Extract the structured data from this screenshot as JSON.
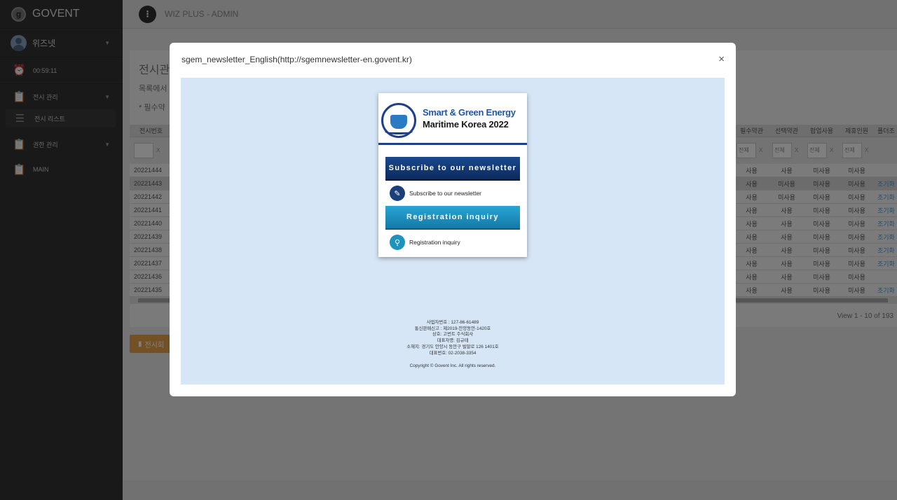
{
  "app": {
    "brand": "GOVENT",
    "top_title": "WIZ PLUS - ADMIN"
  },
  "sidebar": {
    "user": "위즈넷",
    "timer": "00:59:11",
    "items": [
      {
        "label": "전시 관리"
      },
      {
        "label": "전시 리스트"
      },
      {
        "label": "권한 관리"
      },
      {
        "label": "MAIN"
      }
    ]
  },
  "page": {
    "title": "전시관",
    "desc": "목록에서",
    "note": "* 필수약",
    "add_button": "전시회",
    "pager": "View 1 - 10 of 193"
  },
  "grid": {
    "headers": {
      "id": "전시번호",
      "req": "필수약관",
      "opt": "선택약관",
      "popup": "팝업사용",
      "partner": "제휴인원",
      "folder": "폴더조"
    },
    "filter_value": "전체",
    "filter_clear": "X",
    "rows": [
      {
        "id": "20221444",
        "req": "사용",
        "opt": "사용",
        "popup": "미사용",
        "partner": "미사용",
        "folder": ""
      },
      {
        "id": "20221443",
        "req": "사용",
        "opt": "미사용",
        "popup": "미사용",
        "partner": "미사용",
        "folder": "조기화"
      },
      {
        "id": "20221442",
        "req": "사용",
        "opt": "미사용",
        "popup": "미사용",
        "partner": "미사용",
        "folder": "조기화"
      },
      {
        "id": "20221441",
        "req": "사용",
        "opt": "사용",
        "popup": "미사용",
        "partner": "미사용",
        "folder": "조기화"
      },
      {
        "id": "20221440",
        "req": "사용",
        "opt": "사용",
        "popup": "미사용",
        "partner": "미사용",
        "folder": "조기화"
      },
      {
        "id": "20221439",
        "req": "사용",
        "opt": "사용",
        "popup": "미사용",
        "partner": "미사용",
        "folder": "조기화"
      },
      {
        "id": "20221438",
        "req": "사용",
        "opt": "사용",
        "popup": "미사용",
        "partner": "미사용",
        "folder": "조기화"
      },
      {
        "id": "20221437",
        "req": "사용",
        "opt": "사용",
        "popup": "미사용",
        "partner": "미사용",
        "folder": "조기화"
      },
      {
        "id": "20221436",
        "req": "사용",
        "opt": "사용",
        "popup": "미사용",
        "partner": "미사용",
        "folder": ""
      },
      {
        "id": "20221435",
        "req": "사용",
        "opt": "사용",
        "popup": "미사용",
        "partner": "미사용",
        "folder": "조기화"
      }
    ]
  },
  "modal": {
    "title": "sgem_newsletter_English(http://sgemnewsletter-en.govent.kr)",
    "close": "×",
    "logo_line1": "Smart & Green Energy",
    "logo_line2": "Maritime Korea 2022",
    "btn_subscribe": "Subscribe to our newsletter",
    "link_subscribe": "Subscribe to our newsletter",
    "btn_registration": "Registration inquiry",
    "link_registration": "Registration inquiry",
    "footer_lines": [
      "사업자번호 : 127-86-61489",
      "통신판매신고 : 제2019-안양동안-1420호",
      "상호: 고번트 주식회사",
      "대표자명: 김규태",
      "소재지: 경기도 안양시 동안구 벌말로 126 1401호",
      "대표번호: 02-2038-3354"
    ],
    "copyright": "Copyright © Govent Inc. All rights reserved."
  }
}
